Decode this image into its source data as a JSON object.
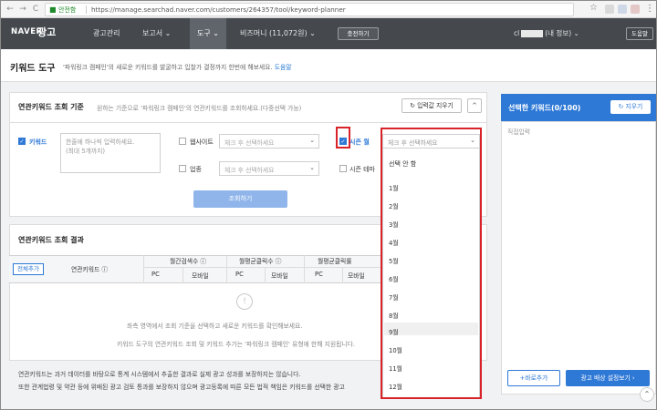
{
  "browser": {
    "back": "←",
    "forward": "→",
    "reload": "C",
    "secure_label": "안전함",
    "url": "https://manage.searchad.naver.com/customers/264357/tool/keyword-planner"
  },
  "header": {
    "brand": "NAVER",
    "brand_ko": "광고",
    "nav": [
      "광고관리",
      "보고서 ⌄",
      "도구 ⌄",
      "비즈머니 (11,072원) ⌄"
    ],
    "charge_button": "충전하기",
    "user_prefix": "cl",
    "user_suffix": "(내 정보) ⌄",
    "help_button": "도움말"
  },
  "title_bar": {
    "title": "키워드 도구",
    "desc": "'파워링크 캠페인'의 새로운 키워드를 발굴하고 입찰가 결정까지 한번에 해보세요.",
    "link": "도움말"
  },
  "query": {
    "title": "연관키워드 조회 기준",
    "desc": "원하는 기준으로 '파워링크 캠페인'의 연관키워드를 조회하세요.(다중선택 가능)",
    "reset_button": "입력값 지우기",
    "collapse_button": "^",
    "keyword_label": "키워드",
    "keyword_placeholder_1": "한줄에 하나씩 입력하세요.",
    "keyword_placeholder_2": "(최대 5개까지)",
    "website_label": "웹사이트",
    "website_placeholder": "체크 후 선택하세요",
    "industry_label": "업종",
    "industry_placeholder": "체크 후 선택하세요",
    "season_month_label": "시즌 월",
    "season_month_placeholder": "체크 후 선택하세요",
    "season_theme_label": "시즌 테마",
    "search_button": "조회하기"
  },
  "results": {
    "title": "연관키워드 조회 결과",
    "add_all": "전체추가",
    "col_keyword": "연관키워드 ⓘ",
    "col_monthly_search": "월간검색수 ⓘ",
    "col_monthly_clicks": "월평균클릭수 ⓘ",
    "col_monthly_ctr": "월평균클릭률",
    "pc": "PC",
    "mobile": "모바일",
    "empty_icon": "!",
    "empty_line1": "좌측 영역에서 조회 기준을 선택하고 새로운 키워드를 확인해보세요.",
    "empty_line2": "키워드 도구의 연관키워드 조회 및 키워드 추가는 '파워링크 캠페인' 유형에 한해 지원됩니다."
  },
  "notes": {
    "line1": "연관키워드는 과거 데이터를 바탕으로 통계 시스템에서 추출한 결과로 실제 광고 성과를 보장하지는 않습니다.",
    "line2": "또한 관계법령 및 약관 등에 위배된 광고 검토 통과를 보장하지 않으며 광고등록에 따른 모든 법적 책임은 키워드를 선택한 광고"
  },
  "dropdown": {
    "items": [
      "선택 안 함",
      "1월",
      "2월",
      "3월",
      "4월",
      "5월",
      "6월",
      "7월",
      "8월",
      "9월",
      "10월",
      "11월",
      "12월"
    ]
  },
  "selected_panel": {
    "title": "선택한 키워드(0/100)",
    "reset_button": "지우기",
    "placeholder": "직접입력",
    "add_button": "+바로추가",
    "go_button": "광고 배상 설정보기 ›"
  },
  "colors": {
    "header_bg": "#45494e",
    "accent": "#2e78d6",
    "highlight": "#d9232a"
  }
}
